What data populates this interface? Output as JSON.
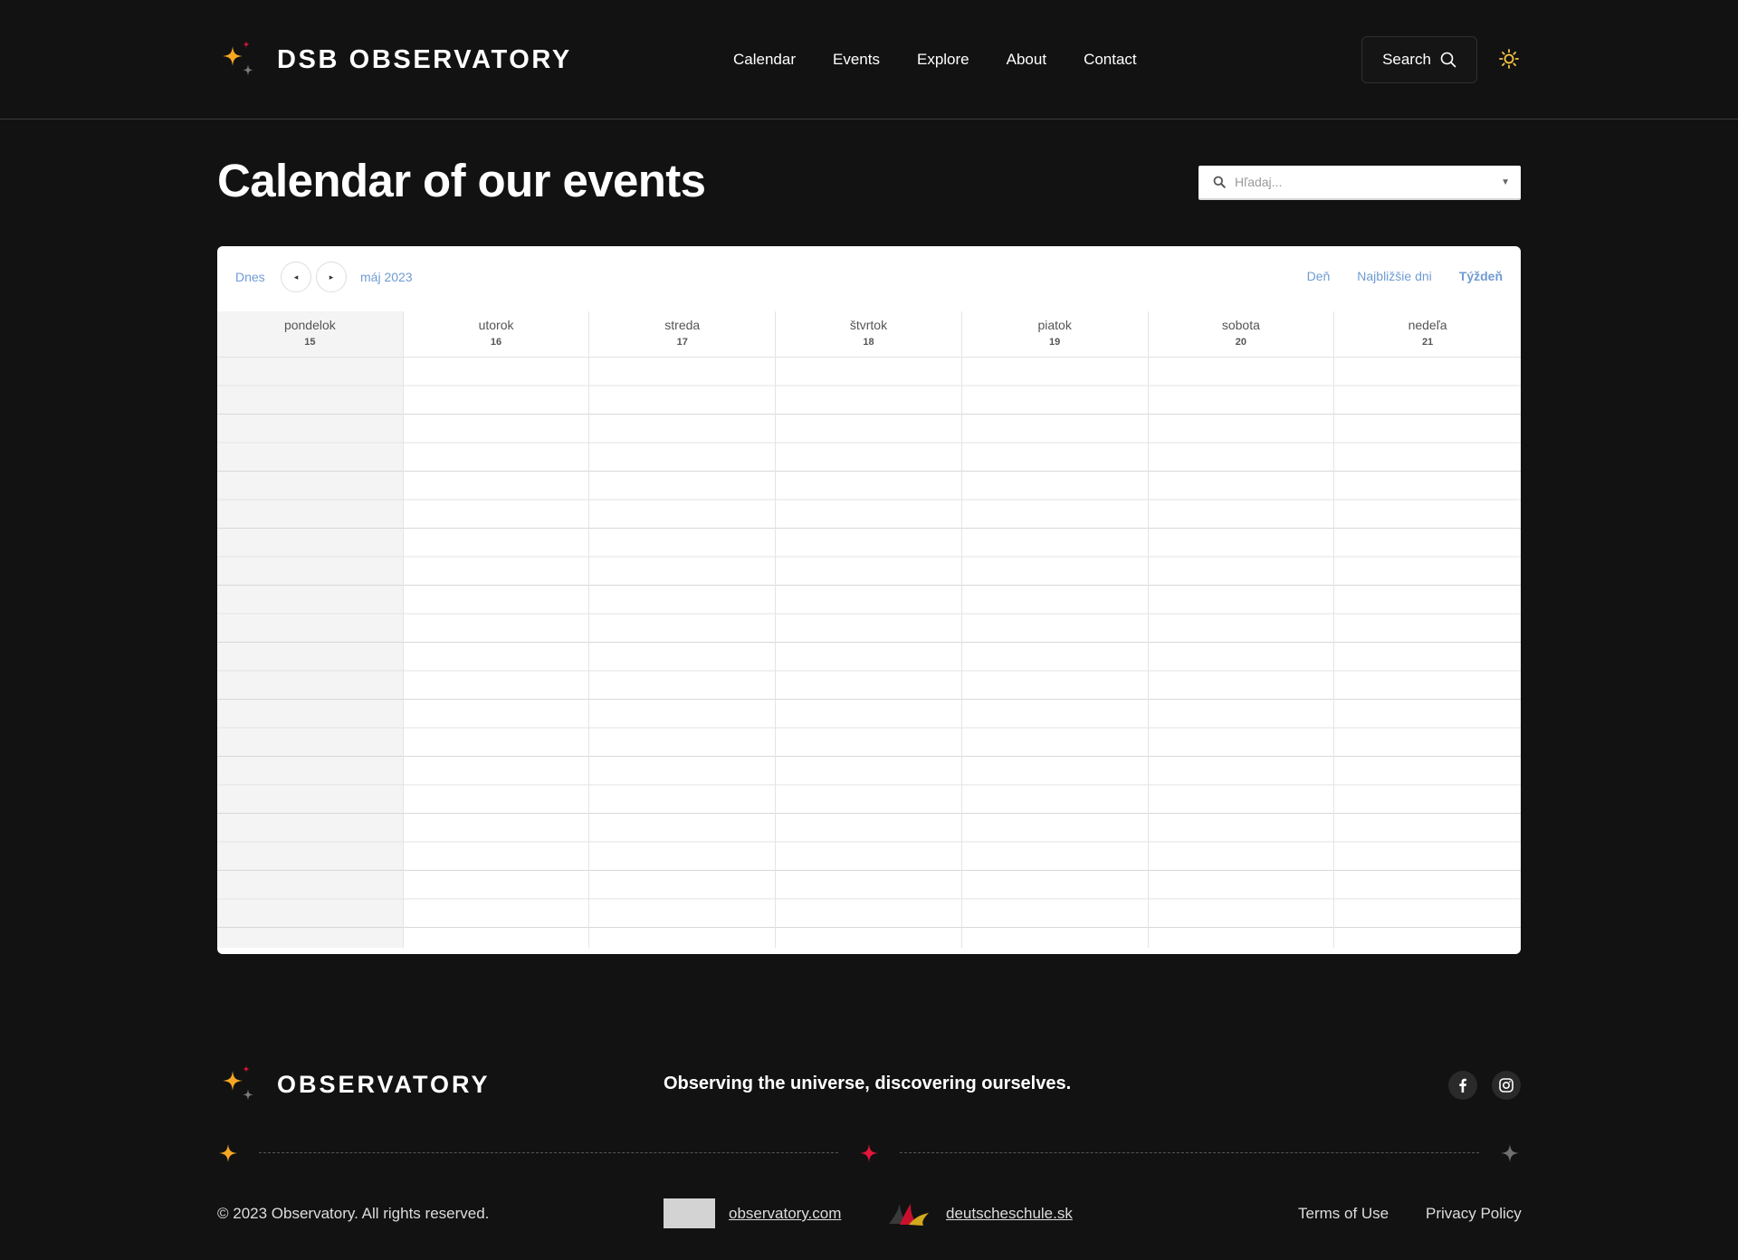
{
  "header": {
    "brand": "DSB OBSERVATORY",
    "nav": [
      "Calendar",
      "Events",
      "Explore",
      "About",
      "Contact"
    ],
    "search_label": "Search"
  },
  "main": {
    "title": "Calendar of our events",
    "search_placeholder": "Hľadaj...",
    "calendar": {
      "today_label": "Dnes",
      "prev_label": "◂",
      "next_label": "▸",
      "month_label": "máj 2023",
      "views": [
        "Deň",
        "Najbližšie dni",
        "Týždeň"
      ],
      "active_view": "Týždeň",
      "days": [
        {
          "name": "pondelok",
          "num": "15",
          "today": true
        },
        {
          "name": "utorok",
          "num": "16",
          "today": false
        },
        {
          "name": "streda",
          "num": "17",
          "today": false
        },
        {
          "name": "štvrtok",
          "num": "18",
          "today": false
        },
        {
          "name": "piatok",
          "num": "19",
          "today": false
        },
        {
          "name": "sobota",
          "num": "20",
          "today": false
        },
        {
          "name": "nedeľa",
          "num": "21",
          "today": false
        }
      ]
    }
  },
  "footer": {
    "brand": "OBSERVATORY",
    "tagline": "Observing the universe, discovering ourselves.",
    "social": [
      "facebook-icon",
      "instagram-icon"
    ],
    "copyright": "© 2023 Observatory. All rights reserved.",
    "partner1": "observatory.com",
    "partner2": "deutscheschule.sk",
    "terms": "Terms of Use",
    "privacy": "Privacy Policy"
  },
  "colors": {
    "background": "#121212",
    "accent_orange": "#f5a623",
    "accent_red": "#e3153a",
    "link_blue": "#6f9bd3",
    "today_column": "#f4f4f4"
  }
}
